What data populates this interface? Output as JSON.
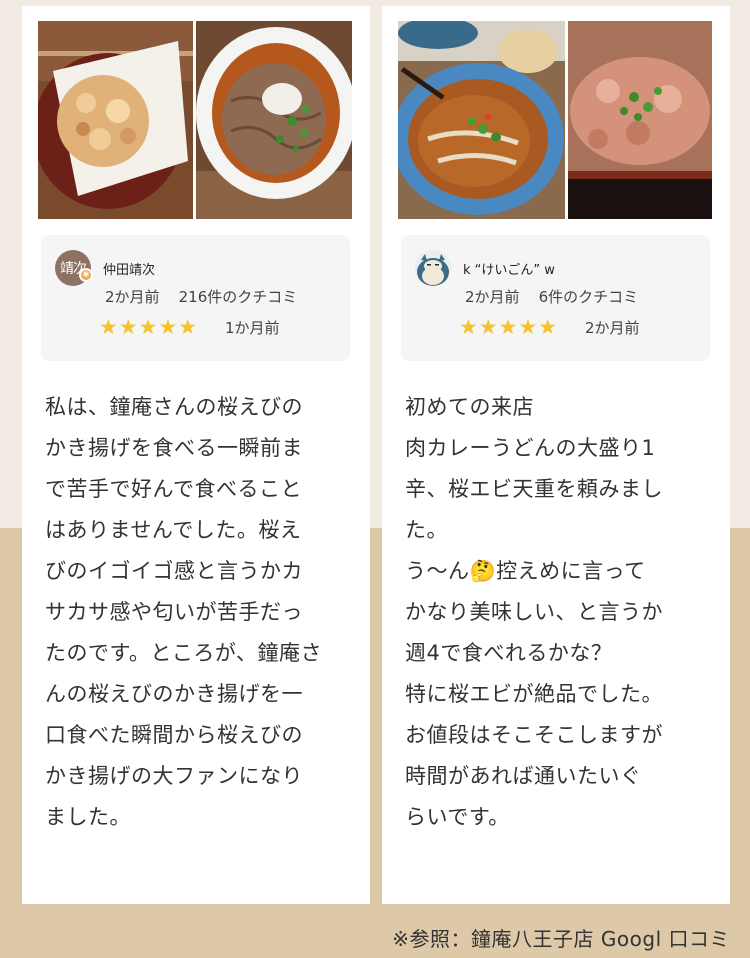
{
  "reviews": [
    {
      "reviewer": {
        "name": "仲田靖次",
        "avatar_text": "靖次",
        "avatar_color": "#8d7264",
        "timeago": "2か月前",
        "review_count": "216件のクチコミ"
      },
      "rating_stars": "★★★★★",
      "rating": 5,
      "review_age": "1か月前",
      "photos": [
        "kakiage-tempura-photo",
        "oroshi-soba-photo"
      ],
      "body_lines": [
        "私は、鐘庵さんの桜えびの",
        "かき揚げを食べる一瞬前ま",
        "で苦手で好んで食べること",
        "はありませんでした。桜え",
        "びのイゴイゴ感と言うかカ",
        "サカサ感や匂いが苦手だっ",
        "たのです。ところが、鐘庵さ",
        "んの桜えびのかき揚げを一",
        "口食べた瞬間から桜えびの",
        "かき揚げの大ファンになり",
        "ました。"
      ]
    },
    {
      "reviewer": {
        "name": "k “けいごん” w",
        "avatar_text": "",
        "avatar_color": "#5b7d96",
        "timeago": "2か月前",
        "review_count": "6件のクチコミ"
      },
      "rating_stars": "★★★★★",
      "rating": 5,
      "review_age": "2か月前",
      "photos": [
        "curry-udon-photo",
        "sakura-ebi-tendon-photo"
      ],
      "body_lines": [
        "初めての来店",
        "肉カレーうどんの大盛り1",
        "辛、桜エビ天重を頼みまし",
        "た。",
        "う〜ん🤔控えめに言って",
        "かなり美味しい、と言うか",
        "週4で食べれるかな？",
        "特に桜エビが絶品でした。",
        "お値段はそこそこしますが",
        "時間があれば通いたいぐ",
        "らいです。"
      ]
    }
  ],
  "footnote": "※参照：鐘庵八王子店 Googl 口コミ",
  "colors": {
    "background_top": "#f1ebe4",
    "background_bottom": "#ddc8a8",
    "star": "#f6c32c",
    "meta_panel": "#f5f5f5"
  }
}
